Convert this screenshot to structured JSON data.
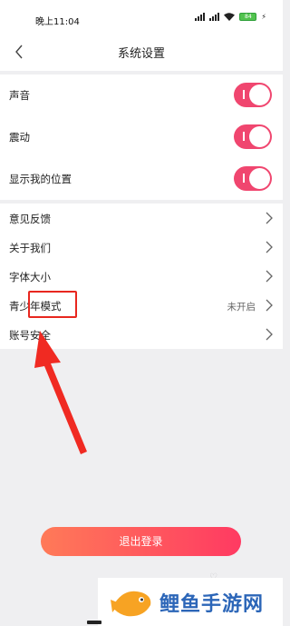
{
  "status_bar": {
    "time": "晚上11:04",
    "battery": "84"
  },
  "nav": {
    "title": "系统设置"
  },
  "toggles": [
    {
      "label": "声音",
      "on": true
    },
    {
      "label": "震动",
      "on": true
    },
    {
      "label": "显示我的位置",
      "on": true
    }
  ],
  "menu": [
    {
      "label": "意见反馈",
      "value": ""
    },
    {
      "label": "关于我们",
      "value": ""
    },
    {
      "label": "字体大小",
      "value": ""
    },
    {
      "label": "青少年模式",
      "value": "未开启"
    },
    {
      "label": "账号安全",
      "value": ""
    }
  ],
  "logout_label": "退出登录",
  "watermark": {
    "text": "鲤鱼手游网"
  },
  "colors": {
    "accent": "#f0466f",
    "highlight": "#e8271f",
    "watermark_blue": "#2c66b8"
  }
}
